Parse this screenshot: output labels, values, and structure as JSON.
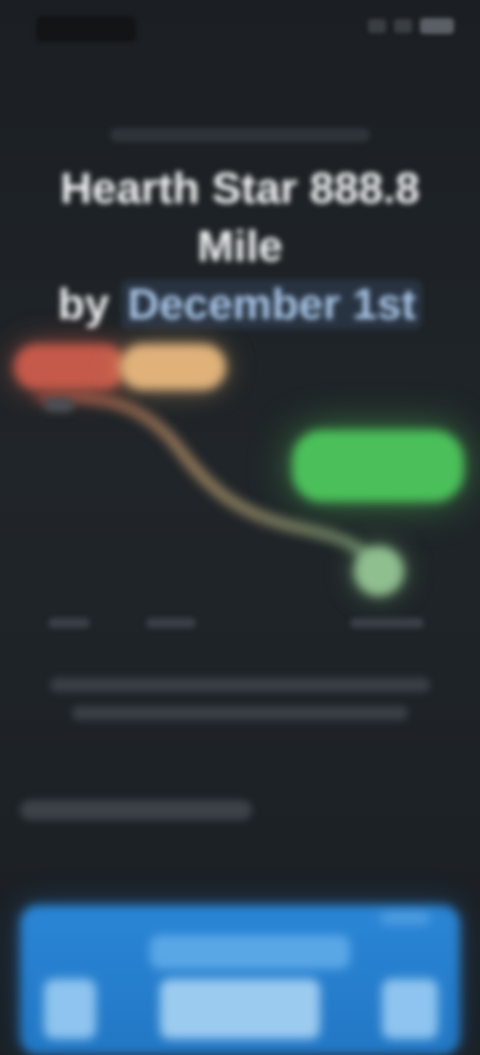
{
  "status_bar": {
    "left_icon": "carrier-logo-icon",
    "right_icons": [
      "signal-icon",
      "wifi-icon",
      "battery-icon"
    ]
  },
  "hero": {
    "eyebrow": "",
    "headline_line1": "Hearth Star 888.8 Mile",
    "headline_line2_prefix": "by",
    "headline_accent": "December 1st"
  },
  "chart_data": {
    "type": "line",
    "x": [],
    "series": [],
    "colors": {
      "curve_start": "#c55a4a",
      "curve_mid": "#e0b27a",
      "curve_end": "#8fbe8f",
      "goal": "#4bc05a"
    }
  },
  "chart_labels": {
    "start_pill": "",
    "mid_pill": "",
    "goal_pill": "",
    "x_labels": [
      "",
      "",
      ""
    ]
  },
  "caption": {
    "line1": "",
    "line2": ""
  },
  "section": {
    "title": ""
  },
  "promo_card": {
    "title": "",
    "accent_color": "#2a86d6"
  }
}
